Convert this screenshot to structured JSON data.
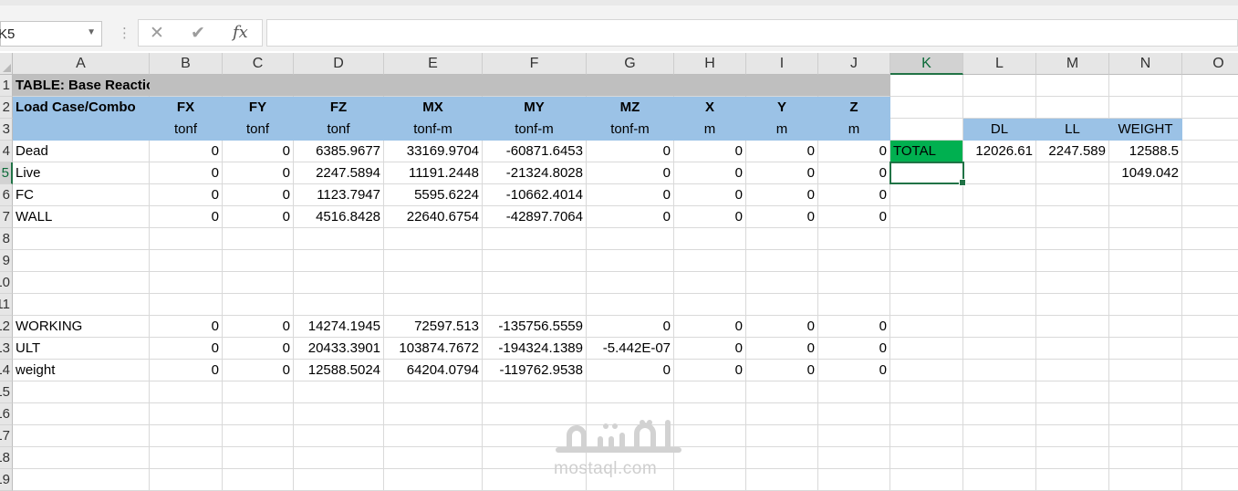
{
  "name_box": {
    "value": "K5"
  },
  "formula_bar": {
    "cancel_icon": "✕",
    "enter_icon": "✔",
    "function_icon": "fx",
    "value": ""
  },
  "columns": [
    "A",
    "B",
    "C",
    "D",
    "E",
    "F",
    "G",
    "H",
    "I",
    "J",
    "K",
    "L",
    "M",
    "N",
    "O"
  ],
  "rows": [
    "1",
    "2",
    "3",
    "4",
    "5",
    "6",
    "7",
    "8",
    "9",
    "10",
    "11",
    "12",
    "13",
    "14",
    "15",
    "16",
    "17",
    "18",
    "19"
  ],
  "table": {
    "title": "TABLE:  Base Reactions",
    "headers": [
      "Load Case/Combo",
      "FX",
      "FY",
      "FZ",
      "MX",
      "MY",
      "MZ",
      "X",
      "Y",
      "Z"
    ],
    "units": [
      "",
      "tonf",
      "tonf",
      "tonf",
      "tonf-m",
      "tonf-m",
      "tonf-m",
      "m",
      "m",
      "m"
    ],
    "data": [
      {
        "row": 4,
        "cells": [
          "Dead",
          "0",
          "0",
          "6385.9677",
          "33169.9704",
          "-60871.6453",
          "0",
          "0",
          "0",
          "0"
        ]
      },
      {
        "row": 5,
        "cells": [
          "Live",
          "0",
          "0",
          "2247.5894",
          "11191.2448",
          "-21324.8028",
          "0",
          "0",
          "0",
          "0"
        ]
      },
      {
        "row": 6,
        "cells": [
          "FC",
          "0",
          "0",
          "1123.7947",
          "5595.6224",
          "-10662.4014",
          "0",
          "0",
          "0",
          "0"
        ]
      },
      {
        "row": 7,
        "cells": [
          "WALL",
          "0",
          "0",
          "4516.8428",
          "22640.6754",
          "-42897.7064",
          "0",
          "0",
          "0",
          "0"
        ]
      },
      {
        "row": 12,
        "cells": [
          "WORKING",
          "0",
          "0",
          "14274.1945",
          "72597.513",
          "-135756.5559",
          "0",
          "0",
          "0",
          "0"
        ]
      },
      {
        "row": 13,
        "cells": [
          "ULT",
          "0",
          "0",
          "20433.3901",
          "103874.7672",
          "-194324.1389",
          "-5.442E-07",
          "0",
          "0",
          "0"
        ]
      },
      {
        "row": 14,
        "cells": [
          "weight",
          "0",
          "0",
          "12588.5024",
          "64204.0794",
          "-119762.9538",
          "0",
          "0",
          "0",
          "0"
        ]
      }
    ]
  },
  "summary": {
    "headers": [
      "DL",
      "LL",
      "WEIGHT"
    ],
    "total_label": "TOTAL",
    "total_values": [
      "12026.61",
      "2247.589",
      "12588.5"
    ],
    "extra_value": "1049.042"
  },
  "selected_cell": "K5",
  "colors": {
    "header_blue": "#9bc2e6",
    "title_gray": "#bfbfbf",
    "total_green": "#00b050",
    "excel_green": "#217346"
  },
  "watermark": {
    "arabic": "مستقل",
    "latin": "mostaql.com"
  }
}
